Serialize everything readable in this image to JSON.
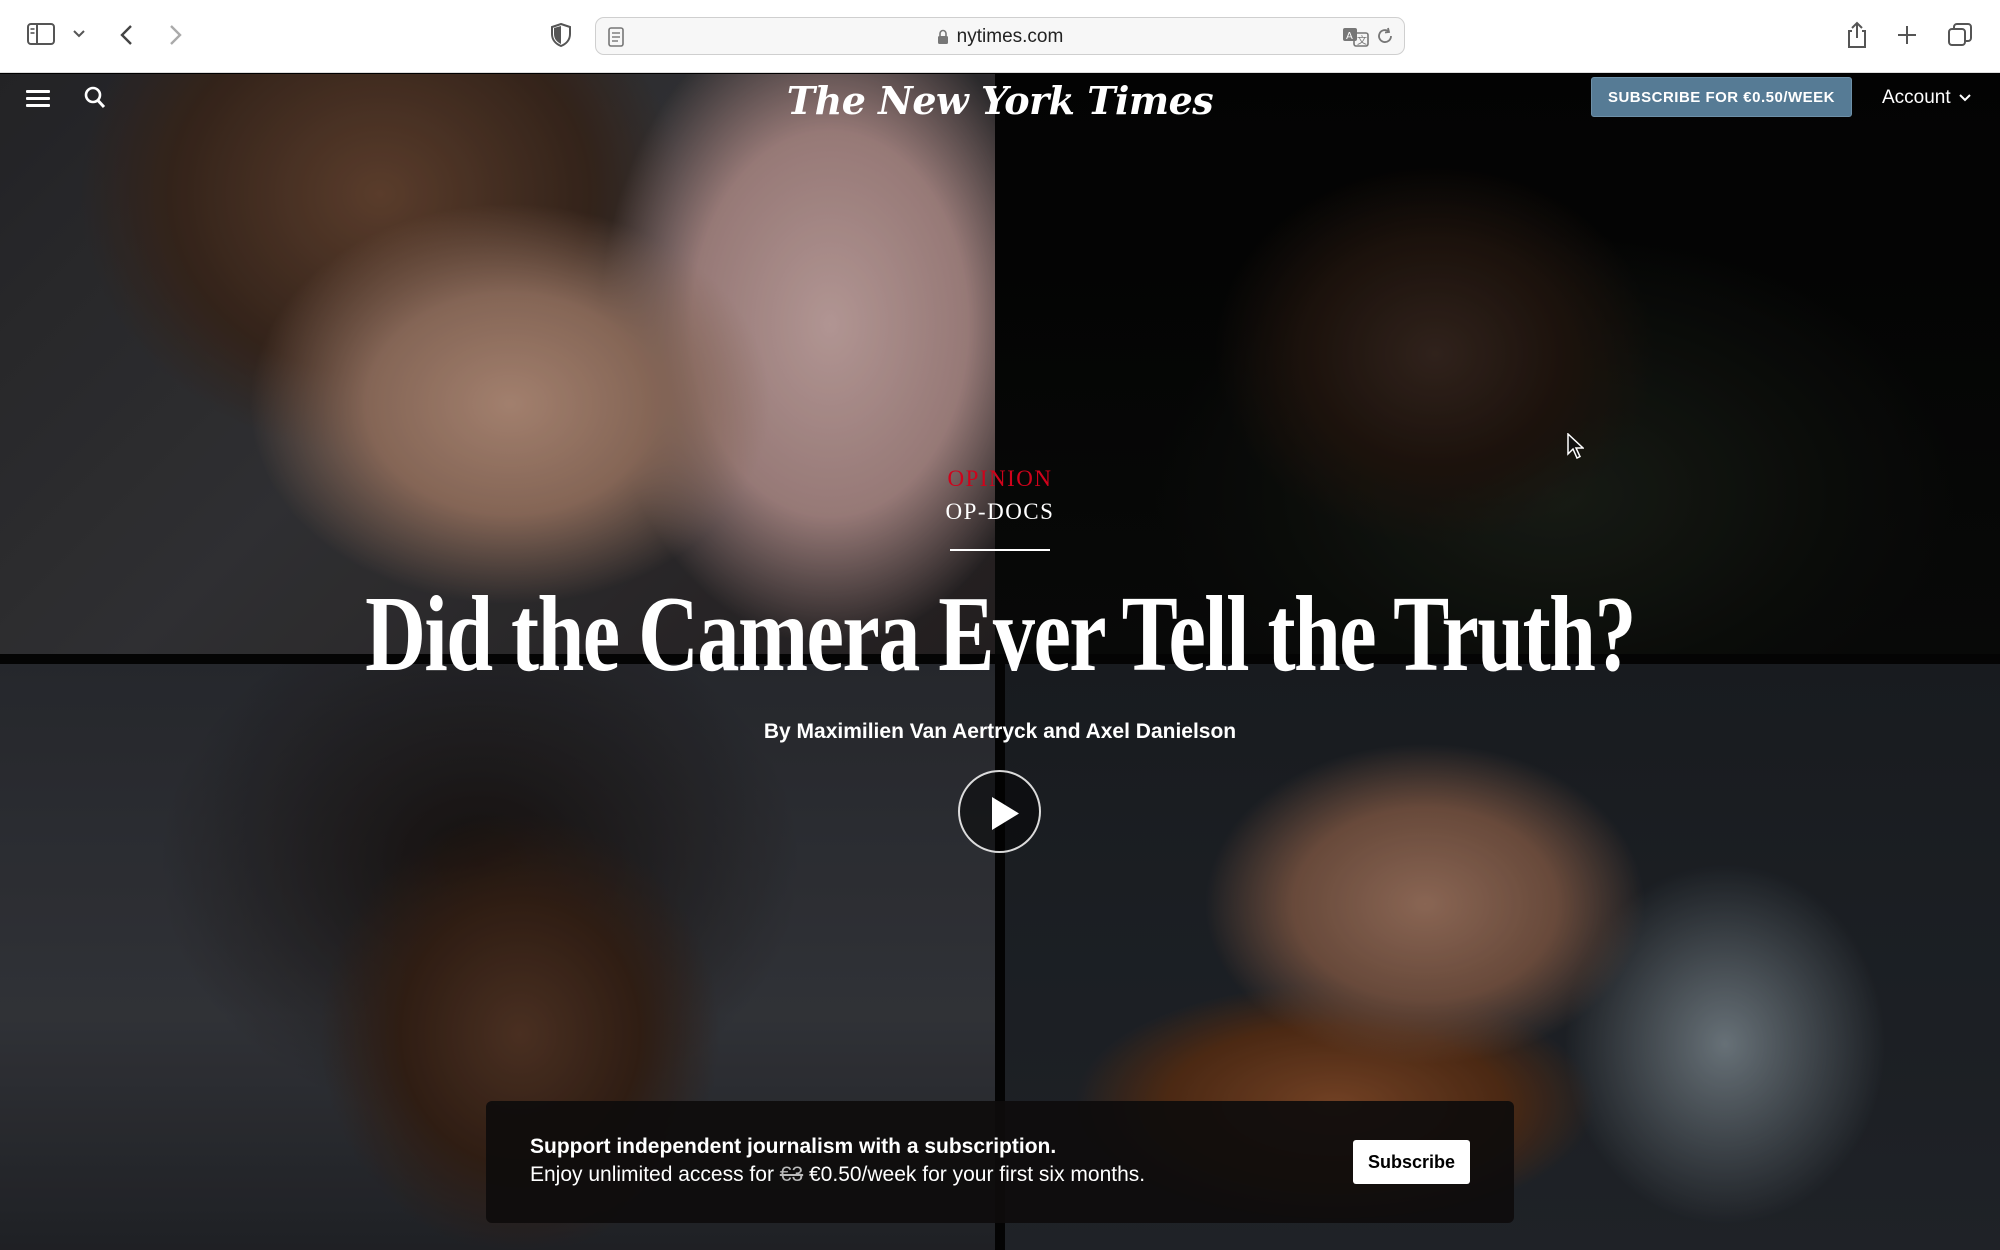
{
  "browser": {
    "url": "nytimes.com",
    "icons": {
      "sidebar": "sidebar-icon",
      "back": "chevron-left-icon",
      "forward": "chevron-right-icon",
      "privacy": "shield-icon",
      "lock": "lock-icon",
      "translate": "translate-icon",
      "reload": "reload-icon",
      "share": "share-icon",
      "new_tab": "plus-icon",
      "tabs": "tabs-icon"
    }
  },
  "masthead": {
    "logo": "The New York Times",
    "subscribe_label": "SUBSCRIBE FOR €0.50/WEEK",
    "account_label": "Account",
    "subscribe_color": "#567b95"
  },
  "article": {
    "section": "OPINION",
    "subsection": "OP-DOCS",
    "headline": "Did the Camera Ever Tell the Truth?",
    "byline": "By Maximilien Van Aertryck and Axel Danielson",
    "section_color": "#d0021b"
  },
  "banner": {
    "title": "Support independent journalism with a subscription.",
    "line_prefix": "Enjoy unlimited access for",
    "old_price": "€3",
    "line_suffix": "€0.50/week for your first six months.",
    "button_label": "Subscribe"
  }
}
